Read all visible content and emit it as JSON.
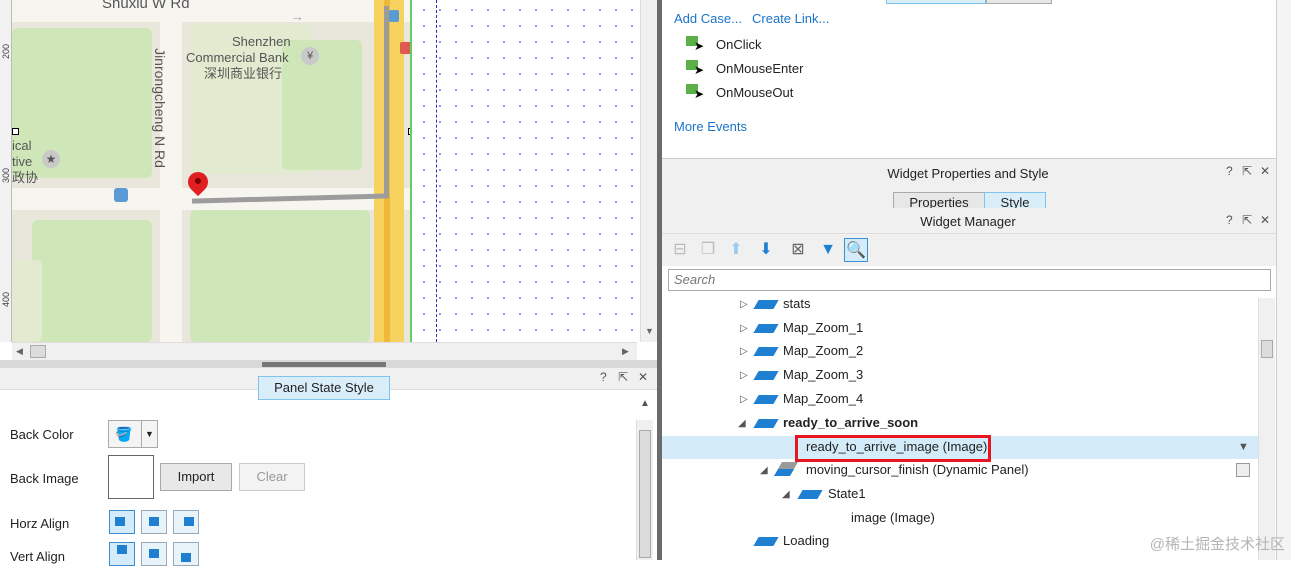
{
  "map": {
    "street_top": "Shuxiu W Rd",
    "street_vertical": "Jinrongcheng N Rd",
    "bank_name": [
      "Shenzhen",
      "Commercial Bank",
      "深圳商业银行"
    ],
    "poi_left": [
      "ical",
      "tive",
      "政协"
    ],
    "ruler_marks": [
      "200",
      "300",
      "400"
    ],
    "marker_icon": "map-pin-icon"
  },
  "panel_state_style": {
    "title": "Panel State Style",
    "help": "?",
    "pin": "⇱",
    "close": "✕",
    "back_color_label": "Back Color",
    "back_image_label": "Back Image",
    "import_label": "Import",
    "clear_label": "Clear",
    "horz_align_label": "Horz Align",
    "vert_align_label": "Vert Align"
  },
  "interactions": {
    "add_case": "Add Case...",
    "create_link": "Create Link...",
    "events": [
      "OnClick",
      "OnMouseEnter",
      "OnMouseOut"
    ],
    "more_events": "More Events"
  },
  "widget_properties": {
    "title": "Widget Properties and Style",
    "tabs": [
      "Properties",
      "Style"
    ],
    "help": "?",
    "pin": "⇱",
    "close": "✕"
  },
  "widget_manager": {
    "title": "Widget Manager",
    "help": "?",
    "pin": "⇱",
    "close": "✕",
    "search_placeholder": "Search",
    "toolbar_icons": [
      "add-folder-icon",
      "copy-icon",
      "move-up-icon",
      "move-down-icon",
      "delete-icon",
      "filter-icon",
      "search-icon"
    ],
    "tree": [
      {
        "label": "stats",
        "expander": "▷",
        "indent": 0
      },
      {
        "label": "Map_Zoom_1",
        "expander": "▷",
        "indent": 0
      },
      {
        "label": "Map_Zoom_2",
        "expander": "▷",
        "indent": 0
      },
      {
        "label": "Map_Zoom_3",
        "expander": "▷",
        "indent": 0
      },
      {
        "label": "Map_Zoom_4",
        "expander": "▷",
        "indent": 0
      },
      {
        "label": "ready_to_arrive_soon",
        "expander": "◢",
        "indent": 0
      },
      {
        "label": "ready_to_arrive_image (Image)",
        "expander": "",
        "indent": 1
      },
      {
        "label": "moving_cursor_finish (Dynamic Panel)",
        "expander": "◢",
        "indent": 1
      },
      {
        "label": "State1",
        "expander": "◢",
        "indent": 2
      },
      {
        "label": "image (Image)",
        "expander": "",
        "indent": 3
      },
      {
        "label": "Loading",
        "expander": "",
        "indent": 0
      }
    ]
  },
  "watermark": "@稀土掘金技术社区",
  "colors": {
    "accent_blue": "#1f7fd0",
    "link_blue": "#1a73c8",
    "highlight_red": "#e8141f",
    "selection_bg": "#d4ebf9",
    "park_green": "#cfe7b8"
  }
}
